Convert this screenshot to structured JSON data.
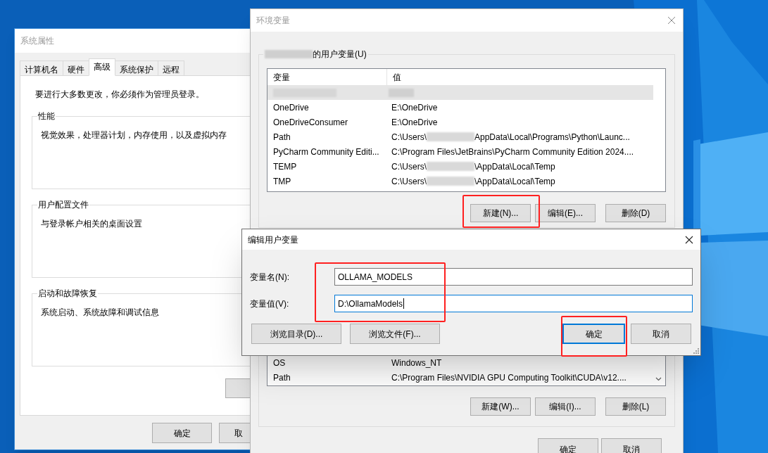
{
  "system_properties": {
    "title": "系统属性",
    "tabs": [
      {
        "label": "计算机名",
        "selected": false
      },
      {
        "label": "硬件",
        "selected": false
      },
      {
        "label": "高级",
        "selected": true
      },
      {
        "label": "系统保护",
        "selected": false
      },
      {
        "label": "远程",
        "selected": false
      }
    ],
    "admin_note": "要进行大多数更改，你必须作为管理员登录。",
    "groups": [
      {
        "legend": "性能",
        "description": "视觉效果，处理器计划，内存使用，以及虚拟内存"
      },
      {
        "legend": "用户配置文件",
        "description": "与登录帐户相关的桌面设置"
      },
      {
        "legend": "启动和故障恢复",
        "description": "系统启动、系统故障和调试信息"
      }
    ],
    "buttons": [
      "确定",
      "取"
    ]
  },
  "environment_variables": {
    "title": "环境变量",
    "user_section": {
      "legend_suffix": "的用户变量(U)",
      "columns": [
        "变量",
        "值"
      ],
      "rows": [
        {
          "kind": "redacted",
          "selected": true
        },
        {
          "kind": "text",
          "name": "OneDrive",
          "value": [
            "E:\\OneDrive"
          ],
          "selected": false
        },
        {
          "kind": "text",
          "name": "OneDriveConsumer",
          "value": [
            "E:\\OneDrive"
          ],
          "selected": false
        },
        {
          "kind": "text",
          "name": "Path",
          "value": [
            "C:\\Users\\",
            "AppData\\Local\\Programs\\Python\\Launc..."
          ],
          "selected": false
        },
        {
          "kind": "text",
          "name": "PyCharm Community Editi...",
          "value": [
            "C:\\Program Files\\JetBrains\\PyCharm Community Edition 2024...."
          ],
          "selected": false
        },
        {
          "kind": "text",
          "name": "TEMP",
          "value": [
            "C:\\Users\\",
            "\\AppData\\Local\\Temp"
          ],
          "selected": false
        },
        {
          "kind": "text",
          "name": "TMP",
          "value": [
            "C:\\Users\\",
            "\\AppData\\Local\\Temp"
          ],
          "selected": false
        }
      ],
      "buttons": [
        "新建(N)...",
        "编辑(E)...",
        "删除(D)"
      ]
    },
    "system_section": {
      "rows": [
        {
          "kind": "text",
          "name": "OS",
          "value": [
            "Windows_NT"
          ],
          "selected": false
        },
        {
          "kind": "text",
          "name": "Path",
          "value": [
            "C:\\Program Files\\NVIDIA GPU Computing Toolkit\\CUDA\\v12...."
          ],
          "selected": false
        }
      ],
      "buttons": [
        "新建(W)...",
        "编辑(I)...",
        "删除(L)"
      ]
    },
    "buttons": [
      "确定",
      "取消"
    ]
  },
  "edit_dialog": {
    "title": "编辑用户变量",
    "fields": [
      {
        "label": "变量名(N):",
        "value": "OLLAMA_MODELS",
        "focused": false
      },
      {
        "label": "变量值(V):",
        "value": "D:\\OllamaModels",
        "focused": true
      }
    ],
    "buttons": [
      {
        "label": "浏览目录(D)...",
        "default": false
      },
      {
        "label": "浏览文件(F)...",
        "default": false
      },
      {
        "label": "确定",
        "default": true
      },
      {
        "label": "取消",
        "default": false
      }
    ]
  }
}
